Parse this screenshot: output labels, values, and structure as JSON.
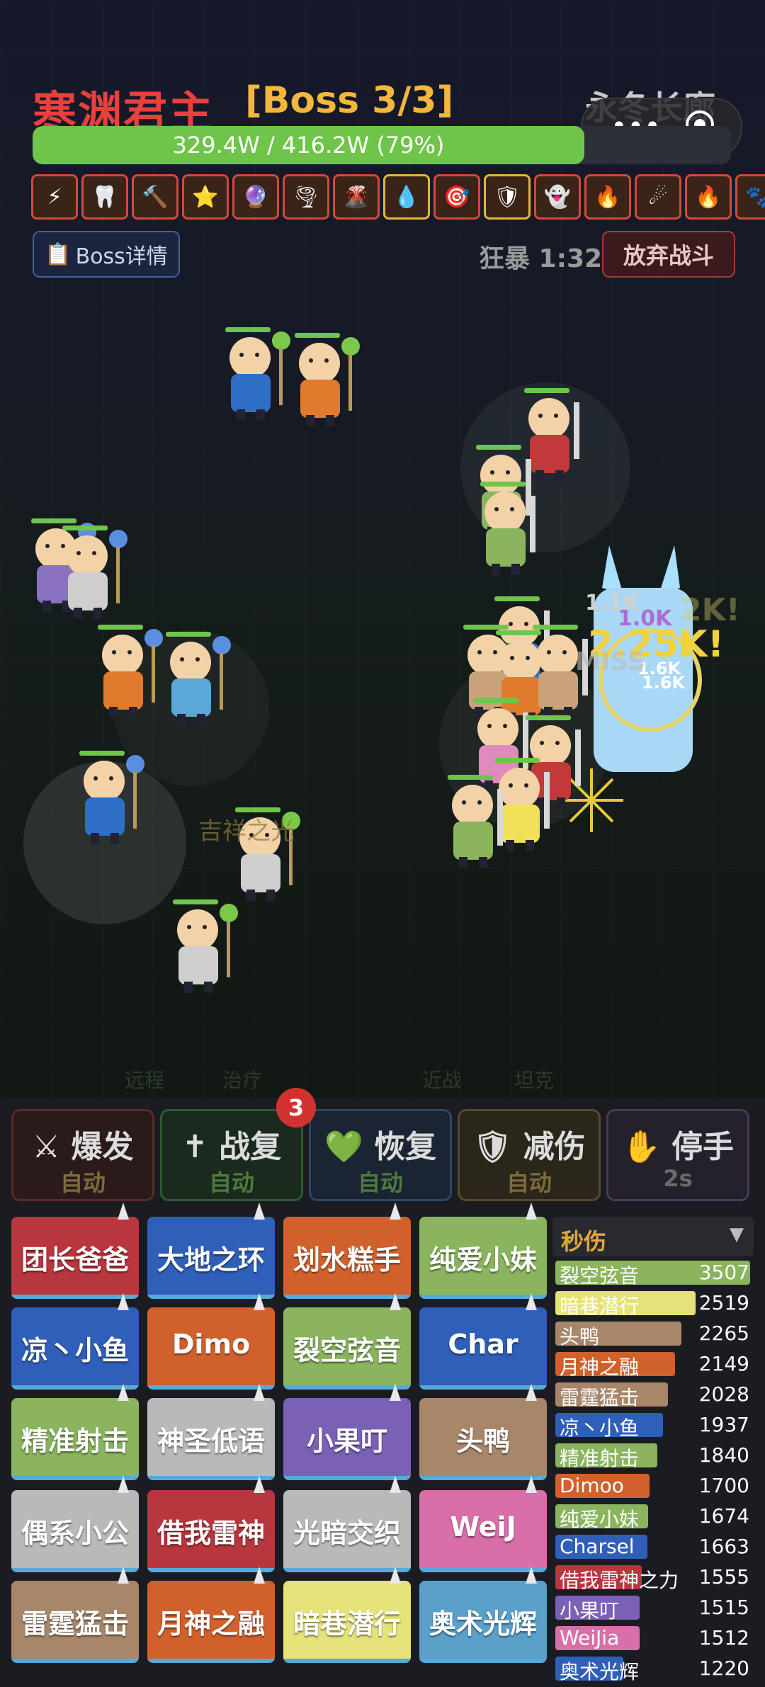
{
  "header": {
    "boss_name": "寒渊君主",
    "boss_stage": "[Boss 3/3]",
    "zone_name": "永冬长廊",
    "hp_text": "329.4W / 416.2W (79%)",
    "hp_fraction": 0.79,
    "detail_label": "Boss详情",
    "rage_label": "狂暴 1:32",
    "quit_label": "放弃战斗"
  },
  "buffs": [
    "⚡",
    "🦷",
    "🔨",
    "⭐",
    "🔮",
    "🌪",
    "🌋",
    "💧",
    "🎯",
    "🛡",
    "👻",
    "🔥",
    "☄",
    "🔥",
    "🐾"
  ],
  "battlefield": {
    "floating_texts": [
      "2.25K!",
      "1.0K",
      "1.1K",
      "1.6K",
      "MISS",
      "2K!",
      "1.6K"
    ],
    "lane_labels": [
      "远程",
      "治疗",
      "近战",
      "坦克"
    ],
    "faded_name": "吉祥之光"
  },
  "skills": [
    {
      "icon": "⚔",
      "name": "爆发",
      "sub": "自动",
      "bg": "#2a1a1a",
      "border": "#5a2a2a",
      "sub_color": "#7d6b3a"
    },
    {
      "icon": "✝",
      "name": "战复",
      "sub": "自动",
      "bg": "#1a2a1e",
      "border": "#2e5a34",
      "sub_color": "#4f7a3e"
    },
    {
      "icon": "💚",
      "name": "恢复",
      "sub": "自动",
      "bg": "#1a2432",
      "border": "#2a4a66",
      "sub_color": "#4f7a3e"
    },
    {
      "icon": "🛡",
      "name": "减伤",
      "sub": "自动",
      "bg": "#2a261a",
      "border": "#5a4a2a",
      "sub_color": "#7d6b3a"
    },
    {
      "icon": "✋",
      "name": "停手",
      "sub": "2s",
      "bg": "#24202c",
      "border": "#4a3a5a",
      "sub_color": "#6a6a6a"
    }
  ],
  "skill_badge": "3",
  "party": [
    {
      "name": "团长爸爸",
      "color": "#b8363d"
    },
    {
      "name": "大地之环",
      "color": "#2f5fb8"
    },
    {
      "name": "划水糕手",
      "color": "#d0612d"
    },
    {
      "name": "纯爱小妹",
      "color": "#8ab45e"
    },
    {
      "name": "凉丶小鱼",
      "color": "#2f5fb8"
    },
    {
      "name": "Dimo",
      "color": "#d0612d"
    },
    {
      "name": "裂空弦音",
      "color": "#8ab45e"
    },
    {
      "name": "Char",
      "color": "#2f5fb8"
    },
    {
      "name": "精准射击",
      "color": "#8ab45e"
    },
    {
      "name": "神圣低语",
      "color": "#b9b9b9"
    },
    {
      "name": "小果叮",
      "color": "#7a61b5"
    },
    {
      "name": "头鸭",
      "color": "#a8866a"
    },
    {
      "name": "偶系小公",
      "color": "#b9b9b9"
    },
    {
      "name": "借我雷神",
      "color": "#b8363d"
    },
    {
      "name": "光暗交织",
      "color": "#b9b9b9"
    },
    {
      "name": "WeiJ",
      "color": "#d86fa8"
    },
    {
      "name": "雷霆猛击",
      "color": "#a8866a"
    },
    {
      "name": "月神之融",
      "color": "#d0612d"
    },
    {
      "name": "暗巷潜行",
      "color": "#e6e27a"
    },
    {
      "name": "奥术光辉",
      "color": "#5aa0c8"
    }
  ],
  "dps": {
    "title": "秒伤",
    "arrow": "▼",
    "rows": [
      {
        "name": "裂空弦音",
        "value": "3507",
        "color": "#8ab45e"
      },
      {
        "name": "暗巷潜行",
        "value": "2519",
        "color": "#e6e27a"
      },
      {
        "name": "头鸭",
        "value": "2265",
        "color": "#a8866a"
      },
      {
        "name": "月神之融",
        "value": "2149",
        "color": "#d0612d"
      },
      {
        "name": "雷霆猛击",
        "value": "2028",
        "color": "#a8866a"
      },
      {
        "name": "凉丶小鱼",
        "value": "1937",
        "color": "#2f5fb8"
      },
      {
        "name": "精准射击",
        "value": "1840",
        "color": "#8ab45e"
      },
      {
        "name": "Dimoo",
        "value": "1700",
        "color": "#d0612d"
      },
      {
        "name": "纯爱小妹",
        "value": "1674",
        "color": "#8ab45e"
      },
      {
        "name": "Charsel",
        "value": "1663",
        "color": "#2f5fb8"
      },
      {
        "name": "借我雷神之力",
        "value": "1555",
        "color": "#b8363d"
      },
      {
        "name": "小果叮",
        "value": "1515",
        "color": "#7a61b5"
      },
      {
        "name": "WeiJia",
        "value": "1512",
        "color": "#d86fa8"
      },
      {
        "name": "奥术光辉",
        "value": "1220",
        "color": "#2f5fb8"
      }
    ]
  }
}
